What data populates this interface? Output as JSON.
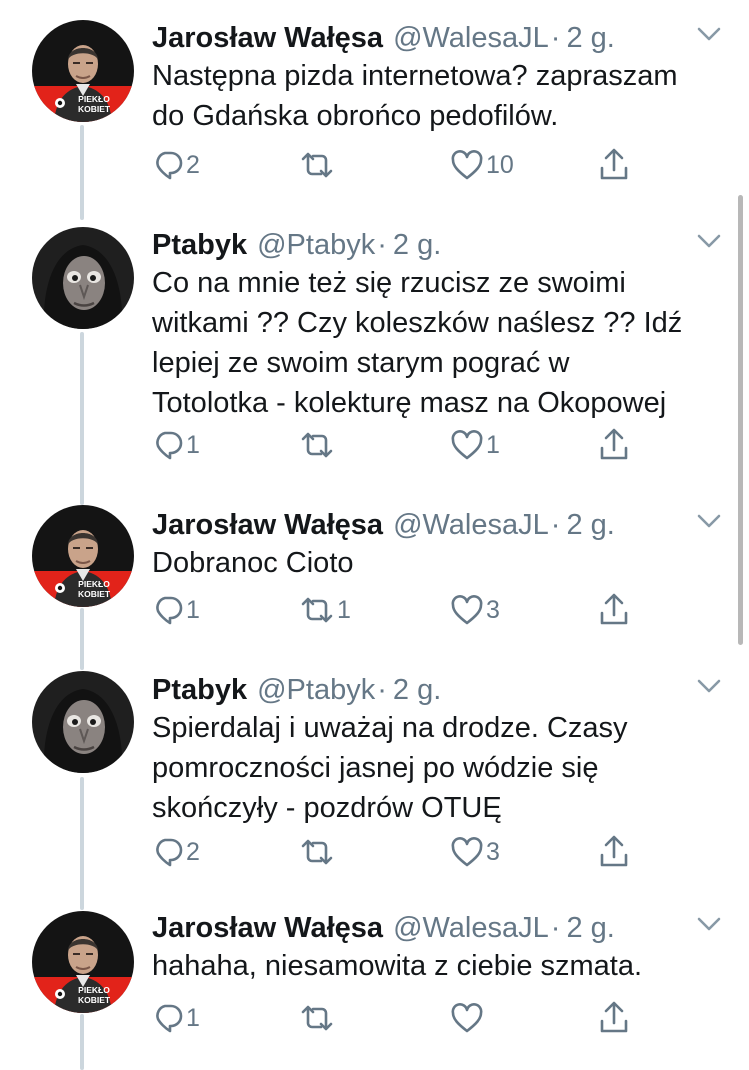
{
  "tweets": [
    {
      "author": "jaroslaw",
      "name": "Jarosław Wałęsa",
      "handle": "@WalesaJL",
      "time": "2 g.",
      "lines": [
        "Następna pizda internetowa? zapraszam",
        "do Gdańska obrońco pedofilów."
      ],
      "replies": "2",
      "retweets": "",
      "likes": "10"
    },
    {
      "author": "ptabyk",
      "name": "Ptabyk",
      "handle": "@Ptabyk",
      "time": "2 g.",
      "lines": [
        "Co na mnie też się rzucisz ze swoimi",
        "witkami ?? Czy koleszków naślesz ?? Idź",
        "lepiej ze swoim starym pograć w",
        "Totolotka - kolekturę masz na Okopowej"
      ],
      "replies": "1",
      "retweets": "",
      "likes": "1"
    },
    {
      "author": "jaroslaw",
      "name": "Jarosław Wałęsa",
      "handle": "@WalesaJL",
      "time": "2 g.",
      "lines": [
        "Dobranoc Cioto"
      ],
      "replies": "1",
      "retweets": "1",
      "likes": "3"
    },
    {
      "author": "ptabyk",
      "name": "Ptabyk",
      "handle": "@Ptabyk",
      "time": "2 g.",
      "lines": [
        "Spierdalaj i uważaj na drodze. Czasy",
        "pomroczności jasnej po wódzie się",
        "skończyły - pozdrów OTUĘ"
      ],
      "replies": "2",
      "retweets": "",
      "likes": "3"
    },
    {
      "author": "jaroslaw",
      "name": "Jarosław Wałęsa",
      "handle": "@WalesaJL",
      "time": "2 g.",
      "lines": [
        "hahaha, niesamowita z ciebie szmata."
      ],
      "replies": "1",
      "retweets": "",
      "likes": ""
    }
  ],
  "avatar_badge_lines": [
    "PIEKŁO",
    "KOBIET"
  ],
  "colors": {
    "text": "#14171a",
    "secondary": "#657786",
    "thread_line": "#ccd6dd",
    "badge_red": "#e2231a"
  },
  "icons": {
    "reply": "reply-icon",
    "retweet": "retweet-icon",
    "like": "heart-icon",
    "share": "share-icon",
    "menu": "chevron-down-icon"
  }
}
